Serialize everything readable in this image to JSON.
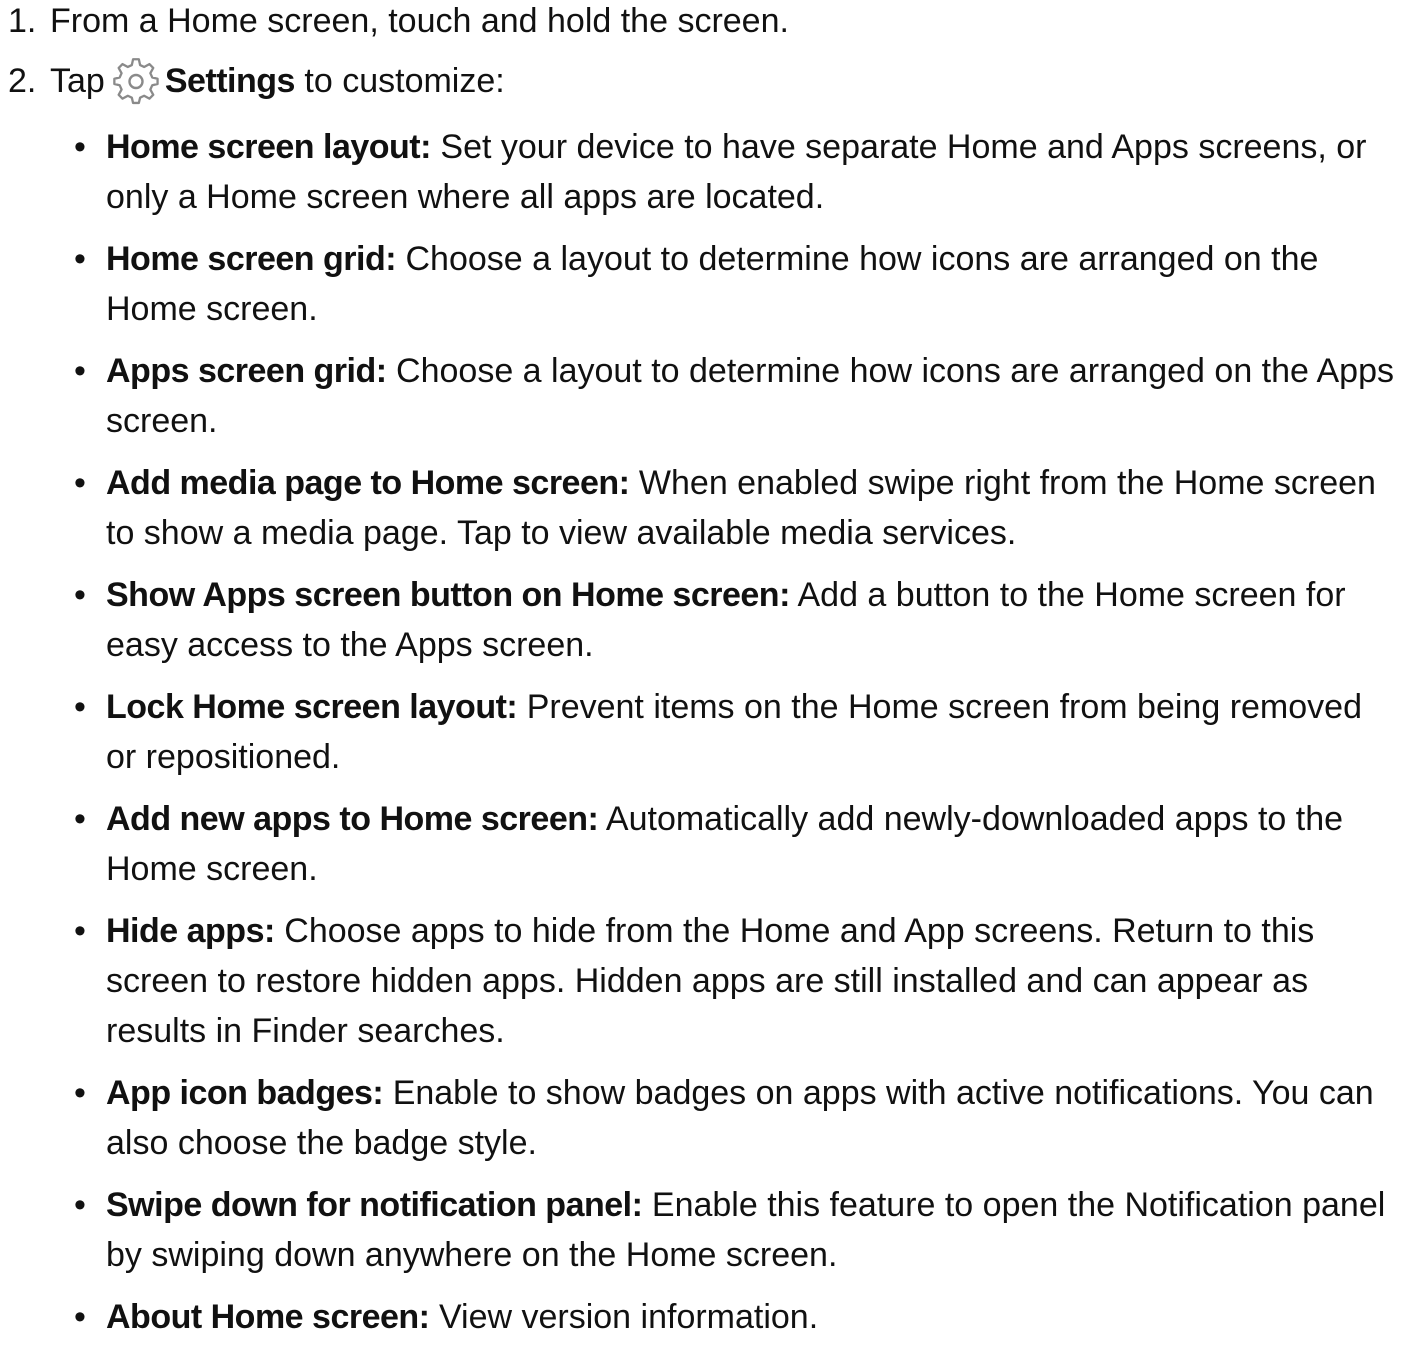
{
  "steps": [
    {
      "number": "1.",
      "text": "From a Home screen, touch and hold the screen."
    },
    {
      "number": "2.",
      "prefix": "Tap",
      "icon": "settings-gear-icon",
      "bold": "Settings",
      "suffix": "to customize:"
    }
  ],
  "bullet_symbol": "•",
  "options": [
    {
      "title": "Home screen layout:",
      "description": "Set your device to have separate Home and Apps screens, or only a Home screen where all apps are located."
    },
    {
      "title": "Home screen grid:",
      "description": "Choose a layout to determine how icons are arranged on the Home screen."
    },
    {
      "title": "Apps screen grid:",
      "description": "Choose a layout to determine how icons are arranged on the Apps screen."
    },
    {
      "title": "Add media page to Home screen:",
      "description": "When enabled swipe right from the Home screen to show a media page. Tap to view available media services."
    },
    {
      "title": "Show Apps screen button on Home screen:",
      "description": "Add a button to the Home screen for easy access to the Apps screen."
    },
    {
      "title": "Lock Home screen layout:",
      "description": "Prevent items on the Home screen from being removed or repositioned."
    },
    {
      "title": "Add new apps to Home screen:",
      "description": "Automatically add newly-downloaded apps to the Home screen."
    },
    {
      "title": "Hide apps:",
      "description": "Choose apps to hide from the Home and App screens. Return to this screen to restore hidden apps. Hidden apps are still installed and can appear as results in Finder searches."
    },
    {
      "title": "App icon badges:",
      "description": "Enable to show badges on apps with active notifications. You can also choose the badge style."
    },
    {
      "title": "Swipe down for notification panel:",
      "description": "Enable this feature to open the Notification panel by swiping down anywhere on the Home screen."
    },
    {
      "title": "About Home screen:",
      "description": "View version information."
    }
  ],
  "colors": {
    "text": "#111111",
    "icon_stroke": "#8a8a8a",
    "background": "#ffffff"
  }
}
